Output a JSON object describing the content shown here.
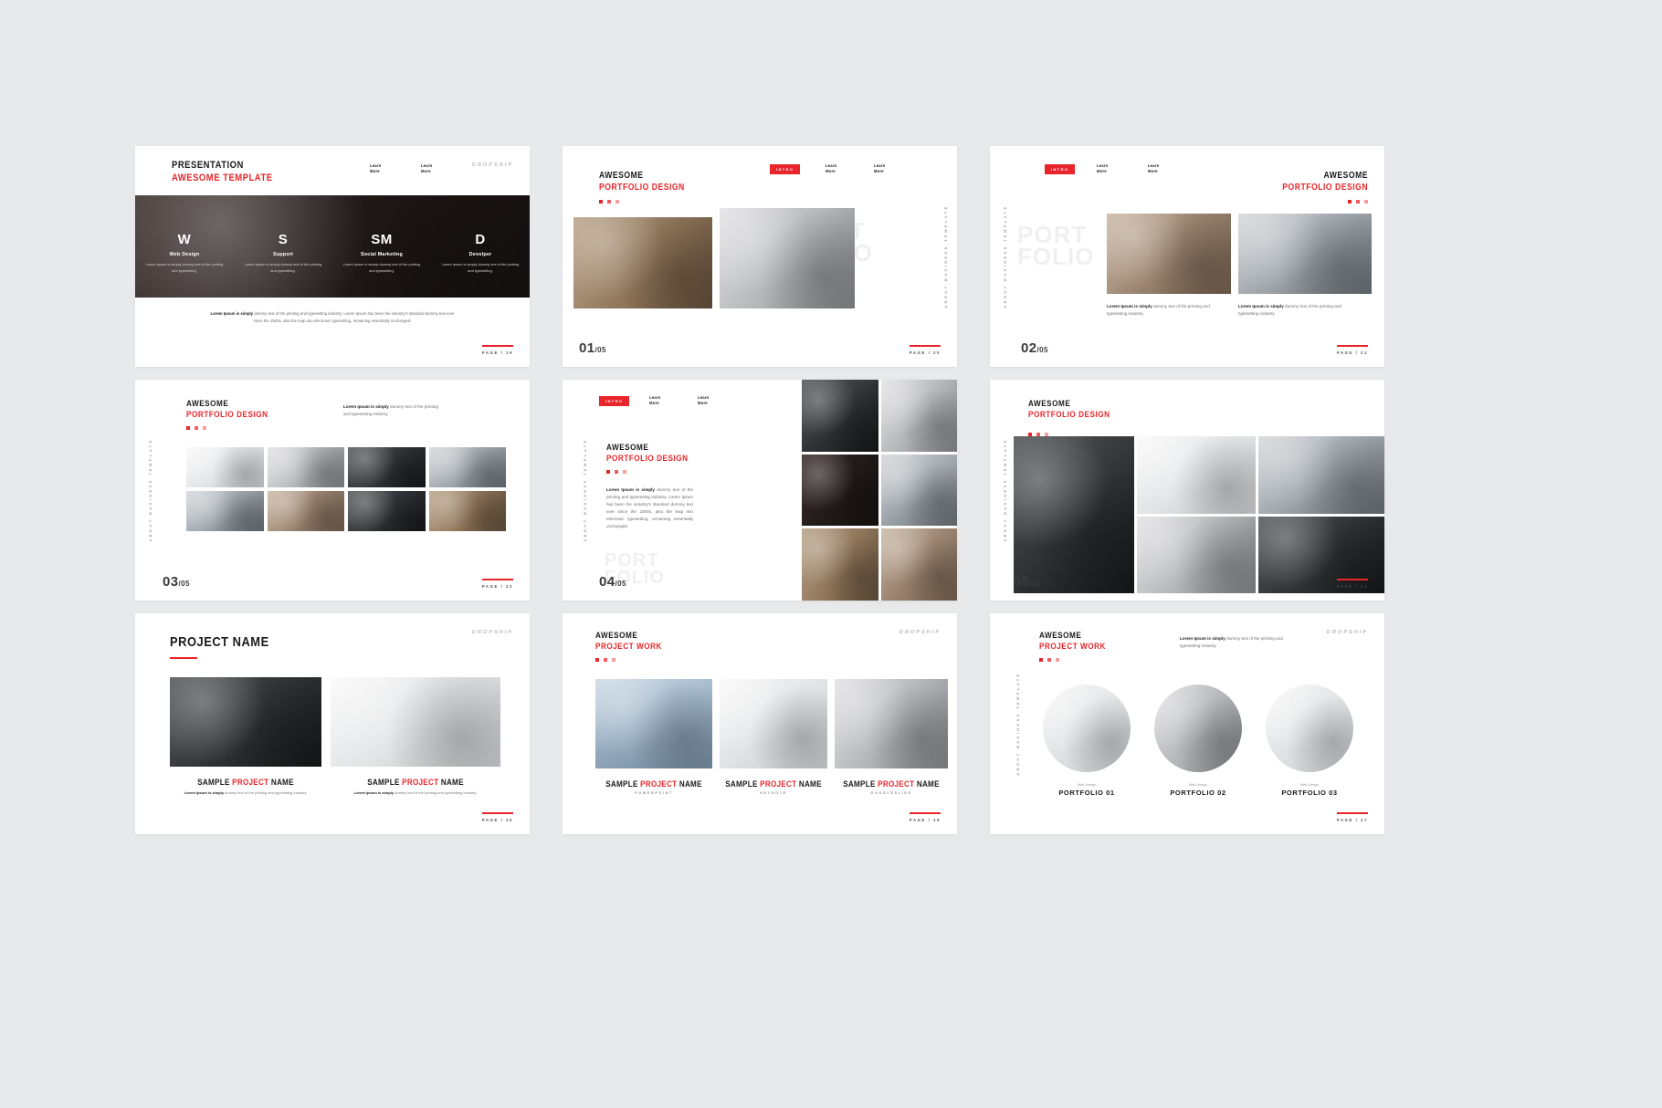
{
  "meta": {
    "background": "#e8e9eb",
    "accent": "#e8252a",
    "ink": "#1a1a1a",
    "brand": "DROPSHIP"
  },
  "common": {
    "learn_more_line1": "Learn",
    "learn_more_line2": "More",
    "intro_badge": "INTRO",
    "vertical_rail": "ABOUT   BUSINESS   TEMPLATE",
    "lorem_short": "Lorem Ipsum is simply",
    "lorem_short_rest": " dummy text of the printing and typesetting industry.",
    "page_prefix": "PAGE /"
  },
  "slides": [
    {
      "id": "slide-01",
      "title_line1": "PRESENTATION",
      "title_line2": "AWESOME TEMPLATE",
      "brand": "DROPSHIP",
      "page": "PAGE / 19",
      "columns": [
        {
          "initial": "W",
          "name": "Web Design",
          "text": "Lorem Ipsum is simply dummy text of the printing and typesetting."
        },
        {
          "initial": "S",
          "name": "Support",
          "text": "Lorem Ipsum is simply dummy text of the printing and typesetting."
        },
        {
          "initial": "SM",
          "name": "Social Marketing",
          "text": "Lorem Ipsum is simply dummy text of the printing and typesetting."
        },
        {
          "initial": "D",
          "name": "Devolper",
          "text": "Lorem Ipsum is simply dummy text of the printing and typesetting."
        }
      ],
      "paragraph_bold": "Lorem Ipsum is simply",
      "paragraph_rest": " dummy text of the printing and typesetting industry. Lorem Ipsum has been the industry's standard dummy text ever since the 1500s, also the leap into electronic typesetting, remaining essentially unchanged."
    },
    {
      "id": "slide-02",
      "title_line1": "AWESOME",
      "title_line2": "PORTFOLIO DESIGN",
      "badge": "INTRO",
      "ghost_line1": "PORT",
      "ghost_line2": "FOLIO",
      "counter_num": "01",
      "counter_den": "05",
      "page": "PAGE / 20",
      "rail": "ABOUT   BUSINESS   TEMPLATE"
    },
    {
      "id": "slide-03",
      "title_line1": "AWESOME",
      "title_line2": "PORTFOLIO DESIGN",
      "badge": "INTRO",
      "ghost_line1": "PORT",
      "ghost_line2": "FOLIO",
      "counter_num": "02",
      "counter_den": "05",
      "page": "PAGE / 21",
      "rail": "ABOUT   BUSINESS   TEMPLATE",
      "captions": [
        {
          "bold": "Lorem Ipsum is simply",
          "rest": " dummy text of the printing and typesetting industry."
        },
        {
          "bold": "Lorem Ipsum is simply",
          "rest": " dummy text of the printing and typesetting industry."
        }
      ]
    },
    {
      "id": "slide-04",
      "title_line1": "AWESOME",
      "title_line2": "PORTFOLIO DESIGN",
      "intro_bold": "Lorem Ipsum is simply",
      "intro_rest": " dummy text of the printing and typesetting industry.",
      "counter_num": "03",
      "counter_den": "05",
      "page": "PAGE / 22",
      "rail": "ABOUT   BUSINESS   TEMPLATE"
    },
    {
      "id": "slide-05",
      "title_line1": "AWESOME",
      "title_line2": "PORTFOLIO DESIGN",
      "badge": "INTRO",
      "body_bold": "Lorem Ipsum is simply",
      "body_rest": " dummy text of the printing and typesetting industry. Lorem Ipsum has been the industry's standard dummy text ever since the 1500s, also the leap into electronic typesetting, remaining essentially unchanged.",
      "ghost_line1": "PORT",
      "ghost_line2": "FOLIO",
      "counter_num": "04",
      "counter_den": "05",
      "page": "PAGE / 23",
      "rail": "ABOUT   BUSINESS   TEMPLATE"
    },
    {
      "id": "slide-06",
      "title_line1": "AWESOME",
      "title_line2": "PORTFOLIO DESIGN",
      "counter_num": "05",
      "counter_den": "05",
      "page": "PAGE / 24",
      "rail": "ABOUT   BUSINESS   TEMPLATE"
    },
    {
      "id": "slide-07",
      "title": "PROJECT NAME",
      "brand": "DROPSHIP",
      "page": "PAGE / 25",
      "items": [
        {
          "a": "SAMPLE ",
          "b": "PROJECT",
          "c": " NAME",
          "bold": "Lorem Ipsum is simply",
          "rest": " dummy text of the printing and typesetting industry."
        },
        {
          "a": "SAMPLE ",
          "b": "PROJECT",
          "c": " NAME",
          "bold": "Lorem Ipsum is simply",
          "rest": " dummy text of the printing and typesetting industry."
        }
      ]
    },
    {
      "id": "slide-08",
      "title_line1": "AWESOME",
      "title_line2": "PROJECT WORK",
      "brand": "DROPSHIP",
      "page": "PAGE / 26",
      "items": [
        {
          "a": "SAMPLE ",
          "b": "PROJECT",
          "c": " NAME",
          "sub": "POWERPOINT"
        },
        {
          "a": "SAMPLE ",
          "b": "PROJECT",
          "c": " NAME",
          "sub": "KEYNOTE"
        },
        {
          "a": "SAMPLE ",
          "b": "PROJECT",
          "c": " NAME",
          "sub": "GOOGLESLIDE"
        }
      ]
    },
    {
      "id": "slide-09",
      "title_line1": "AWESOME",
      "title_line2": "PROJECT WORK",
      "brand": "DROPSHIP",
      "page": "PAGE / 27",
      "rail": "ABOUT   BUSINESS   TEMPLATE",
      "intro_bold": "Lorem Ipsum is simply",
      "intro_rest": " dummy text of the printing and typesetting industry.",
      "items": [
        {
          "kicker": "Web Design",
          "name": "PORTFOLIO 01"
        },
        {
          "kicker": "Web Design",
          "name": "PORTFOLIO 02"
        },
        {
          "kicker": "Web Design",
          "name": "PORTFOLIO 03"
        }
      ]
    }
  ]
}
